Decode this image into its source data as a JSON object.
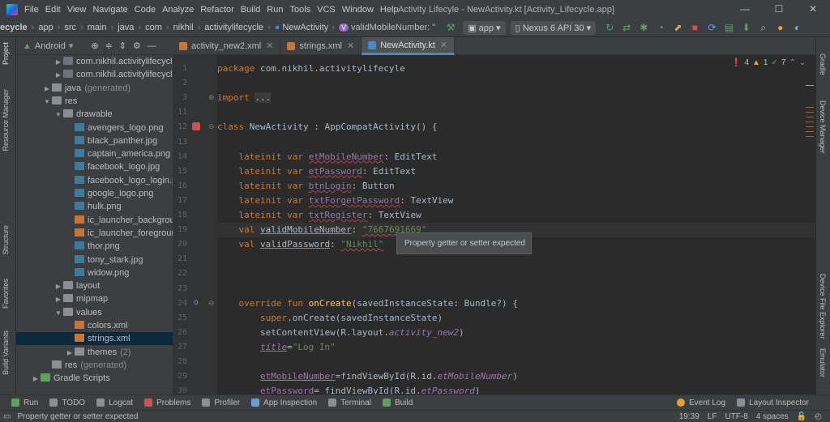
{
  "menu": [
    "File",
    "Edit",
    "View",
    "Navigate",
    "Code",
    "Analyze",
    "Refactor",
    "Build",
    "Run",
    "Tools",
    "VCS",
    "Window",
    "Help"
  ],
  "window_title": "Activity Lifecyle - NewActivity.kt [Activity_Lifecycle.app]",
  "breadcrumb": [
    "ecycle",
    "app",
    "src",
    "main",
    "java",
    "com",
    "nikhil",
    "activitylifecycle"
  ],
  "breadcrumb_class": "NewActivity",
  "breadcrumb_member": "validMobileNumber: \"",
  "run_config": "app",
  "device": "Nexus 6 API 30",
  "project_view": "Android",
  "tree": [
    {
      "label": "com.nikhil.activitylifecycle",
      "suffix": "(andr",
      "indent": 3,
      "icon": "pkg",
      "arrow": "▶"
    },
    {
      "label": "com.nikhil.activitylifecycle",
      "suffix": "(test)",
      "indent": 3,
      "icon": "pkg",
      "arrow": "▶"
    },
    {
      "label": "java",
      "suffix": "(generated)",
      "indent": 2,
      "icon": "folder",
      "arrow": "▶"
    },
    {
      "label": "res",
      "suffix": "",
      "indent": 2,
      "icon": "folder",
      "arrow": "▼"
    },
    {
      "label": "drawable",
      "suffix": "",
      "indent": 3,
      "icon": "folder",
      "arrow": "▼"
    },
    {
      "label": "avengers_logo.png",
      "suffix": "",
      "indent": 4,
      "icon": "img",
      "arrow": ""
    },
    {
      "label": "black_panther.jpg",
      "suffix": "",
      "indent": 4,
      "icon": "img",
      "arrow": ""
    },
    {
      "label": "captain_america.png",
      "suffix": "",
      "indent": 4,
      "icon": "img",
      "arrow": ""
    },
    {
      "label": "facebook_logo.jpg",
      "suffix": "",
      "indent": 4,
      "icon": "img",
      "arrow": ""
    },
    {
      "label": "facebook_logo_login.png",
      "suffix": "",
      "indent": 4,
      "icon": "img",
      "arrow": ""
    },
    {
      "label": "google_logo.png",
      "suffix": "",
      "indent": 4,
      "icon": "img",
      "arrow": ""
    },
    {
      "label": "hulk.png",
      "suffix": "",
      "indent": 4,
      "icon": "img",
      "arrow": ""
    },
    {
      "label": "ic_launcher_background.xml",
      "suffix": "",
      "indent": 4,
      "icon": "xml",
      "arrow": ""
    },
    {
      "label": "ic_launcher_foreground.xml",
      "suffix": "",
      "indent": 4,
      "icon": "xml",
      "arrow": ""
    },
    {
      "label": "thor.png",
      "suffix": "",
      "indent": 4,
      "icon": "img",
      "arrow": ""
    },
    {
      "label": "tony_stark.jpg",
      "suffix": "",
      "indent": 4,
      "icon": "img",
      "arrow": ""
    },
    {
      "label": "widow.png",
      "suffix": "",
      "indent": 4,
      "icon": "img",
      "arrow": ""
    },
    {
      "label": "layout",
      "suffix": "",
      "indent": 3,
      "icon": "folder",
      "arrow": "▶"
    },
    {
      "label": "mipmap",
      "suffix": "",
      "indent": 3,
      "icon": "folder",
      "arrow": "▶"
    },
    {
      "label": "values",
      "suffix": "",
      "indent": 3,
      "icon": "folder",
      "arrow": "▼"
    },
    {
      "label": "colors.xml",
      "suffix": "",
      "indent": 4,
      "icon": "xml",
      "arrow": ""
    },
    {
      "label": "strings.xml",
      "suffix": "",
      "indent": 4,
      "icon": "xml",
      "arrow": "",
      "selected": true
    },
    {
      "label": "themes",
      "suffix": "(2)",
      "indent": 4,
      "icon": "folder",
      "arrow": "▶"
    },
    {
      "label": "res",
      "suffix": "(generated)",
      "indent": 2,
      "icon": "folder",
      "arrow": ""
    },
    {
      "label": "Gradle Scripts",
      "suffix": "",
      "indent": 1,
      "icon": "gradle",
      "arrow": "▶"
    }
  ],
  "tabs": [
    {
      "label": "activity_new2.xml",
      "active": false,
      "icon": "xml"
    },
    {
      "label": "strings.xml",
      "active": false,
      "icon": "xml"
    },
    {
      "label": "NewActivity.kt",
      "active": true,
      "icon": "kt"
    }
  ],
  "inspections": {
    "errors": "4",
    "warnings": "1",
    "weak": "7"
  },
  "code_lines": [
    {
      "n": "1",
      "html": "<span class=\"kw\">package</span> com.nikhil.activitylifecyle"
    },
    {
      "n": "2",
      "html": ""
    },
    {
      "n": "3",
      "html": "<span class=\"kw\">import</span> <span style=\"background:#3a3a3a\">...</span>"
    },
    {
      "n": "11",
      "html": ""
    },
    {
      "n": "12",
      "html": "<span class=\"kw\">class</span> NewActivity : AppCompatActivity() {"
    },
    {
      "n": "13",
      "html": ""
    },
    {
      "n": "14",
      "html": "    <span class=\"kw\">lateinit var</span> <span class=\"prop warn\">etMobileNumber</span>: EditText"
    },
    {
      "n": "15",
      "html": "    <span class=\"kw\">lateinit var</span> <span class=\"prop warn\">etPassword</span>: EditText"
    },
    {
      "n": "16",
      "html": "    <span class=\"kw\">lateinit var</span> <span class=\"prop warn\">btnLogin</span>: Button"
    },
    {
      "n": "17",
      "html": "    <span class=\"kw\">lateinit var</span> <span class=\"prop warn\">txtForgetPassword</span>: TextView"
    },
    {
      "n": "18",
      "html": "    <span class=\"kw\">lateinit var</span> <span class=\"prop warn\">txtRegister</span>: TextView"
    },
    {
      "n": "19",
      "html": "    <span class=\"kw\">val</span> <span class=\"ul\">validMobileNumber</span>: <span class=\"str warn\">\"7667691669\"</span>",
      "current": true
    },
    {
      "n": "20",
      "html": "    <span class=\"kw\">val</span> <span class=\"ul\">validPassword</span>: <span class=\"str warn\">\"Nikhil\"</span>"
    },
    {
      "n": "21",
      "html": ""
    },
    {
      "n": "22",
      "html": ""
    },
    {
      "n": "23",
      "html": ""
    },
    {
      "n": "24",
      "html": "    <span class=\"kw\">override fun</span> <span class=\"fn\">onCreate</span>(savedInstanceState: Bundle?) {"
    },
    {
      "n": "25",
      "html": "        <span class=\"kw\">super</span>.onCreate(savedInstanceState)"
    },
    {
      "n": "26",
      "html": "        setContentView(R.layout.<span class=\"prop it\">activity_new2</span>)"
    },
    {
      "n": "27",
      "html": "        <span class=\"prop it ul\">title</span>=<span class=\"str\">\"Log In\"</span>"
    },
    {
      "n": "28",
      "html": ""
    },
    {
      "n": "29",
      "html": "        <span class=\"prop ul\">etMobileNumber</span>=findViewById(R.id.<span class=\"prop it\">etMobileNumber</span>)"
    },
    {
      "n": "30",
      "html": "        <span class=\"prop ul\">etPassword</span>= findViewById(R.id.<span class=\"prop it\">etPassword</span>)"
    }
  ],
  "tooltip": "Property getter or setter expected",
  "bottom_tools": [
    "Run",
    "TODO",
    "Logcat",
    "Problems",
    "Profiler",
    "App Inspection",
    "Terminal",
    "Build"
  ],
  "bottom_right_tools": [
    "Event Log",
    "Layout Inspector"
  ],
  "status": {
    "message": "Property getter or setter expected",
    "position": "19:39",
    "line_sep": "LF",
    "encoding": "UTF-8",
    "indent": "4 spaces"
  },
  "left_strip": [
    "Project",
    "Resource Manager",
    "Structure",
    "Favorites",
    "Build Variants"
  ],
  "right_strip": [
    "Gradle",
    "Device Manager",
    "Device File Explorer",
    "Emulator"
  ]
}
